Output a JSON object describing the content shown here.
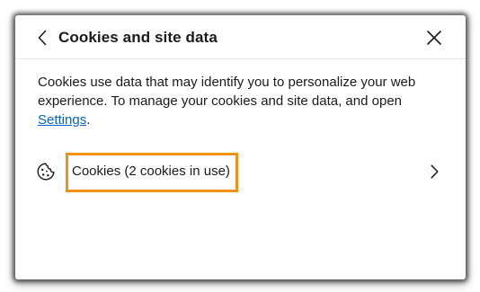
{
  "dialog": {
    "title": "Cookies and site data",
    "description_text": "Cookies use data that may identify you to personalize your web experience. To manage your cookies and site data, and open ",
    "settings_link": "Settings",
    "description_end": ".",
    "cookies_row_label": "Cookies (2 cookies in use)"
  },
  "icons": {
    "back": "chevron-left-icon",
    "close": "close-icon",
    "cookie": "cookie-icon",
    "row_arrow": "chevron-right-icon"
  },
  "colors": {
    "link": "#0a63c8",
    "highlight": "#f0911c",
    "text": "#1b1b1b"
  }
}
